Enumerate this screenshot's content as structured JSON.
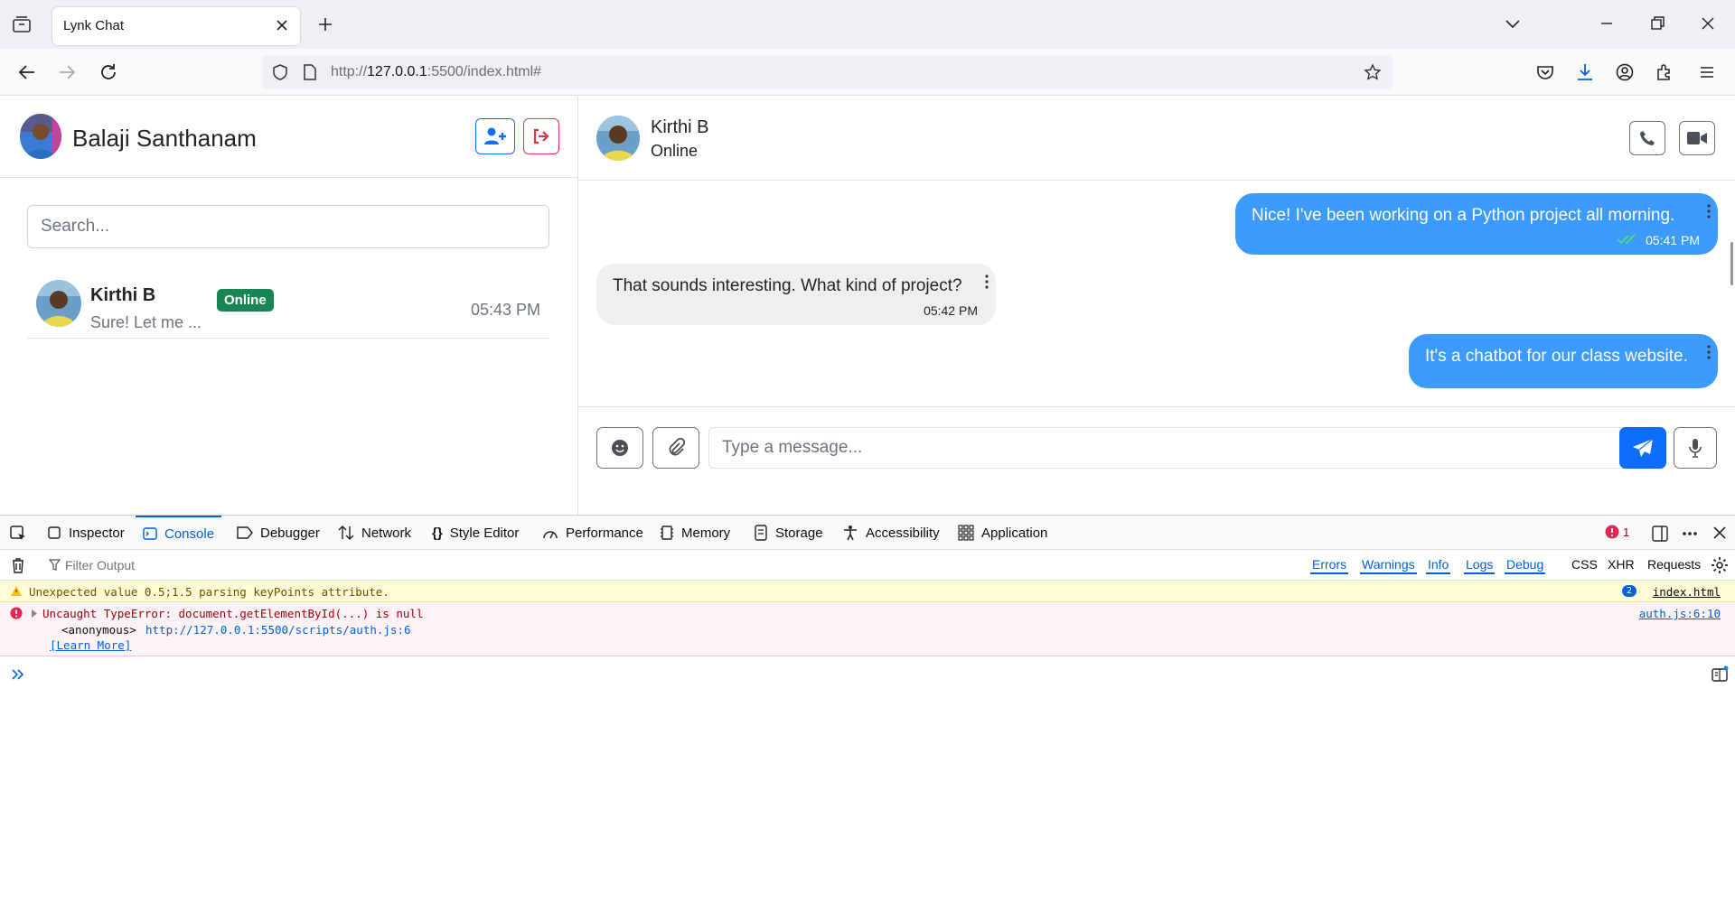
{
  "browser": {
    "tab_title": "Lynk Chat",
    "url_prefix": "http://",
    "url_host": "127.0.0.1",
    "url_rest": ":5500/index.html#"
  },
  "sidebar": {
    "user_name": "Balaji Santhanam",
    "search_placeholder": "Search...",
    "contacts": [
      {
        "name": "Kirthi B",
        "status": "Online",
        "preview": "Sure! Let me ...",
        "time": "05:43 PM"
      }
    ]
  },
  "chat": {
    "contact_name": "Kirthi B",
    "contact_status": "Online",
    "messages": [
      {
        "direction": "sent",
        "text": "Nice! I've been working on a Python project all morning.",
        "time": "05:41 PM",
        "read": true
      },
      {
        "direction": "received",
        "text": "That sounds interesting. What kind of project?",
        "time": "05:42 PM"
      },
      {
        "direction": "sent",
        "text": "It's a chatbot for our class website."
      }
    ],
    "input_placeholder": "Type a message..."
  },
  "devtools": {
    "tabs": [
      "Inspector",
      "Console",
      "Debugger",
      "Network",
      "Style Editor",
      "Performance",
      "Memory",
      "Storage",
      "Accessibility",
      "Application"
    ],
    "active_tab": "Console",
    "error_count": "1",
    "filter_placeholder": "Filter Output",
    "filters": [
      "Errors",
      "Warnings",
      "Info",
      "Logs",
      "Debug"
    ],
    "extra_filters": [
      "CSS",
      "XHR",
      "Requests"
    ],
    "warning": {
      "text": "Unexpected value 0.5;1.5 parsing keyPoints attribute.",
      "count": "2",
      "source": "index.html"
    },
    "error": {
      "text": "Uncaught TypeError: document.getElementById(...) is null",
      "stack_fn": "<anonymous>",
      "stack_url": "http://127.0.0.1:5500/scripts/auth.js:6",
      "learn_more": "[Learn More]",
      "source": "auth.js:6:10"
    }
  },
  "colors": {
    "primary": "#0d6efd",
    "sent_bubble": "#3d9bff",
    "online_badge": "#198754",
    "danger": "#dc3545"
  }
}
